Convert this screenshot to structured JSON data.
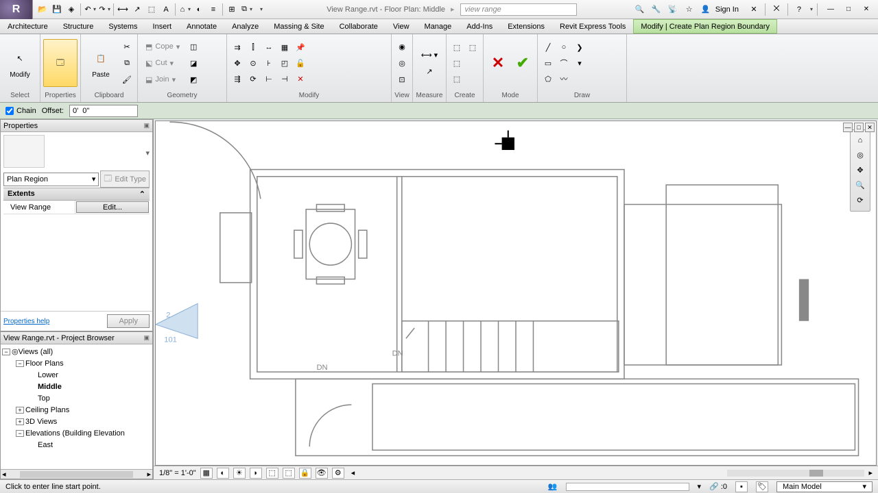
{
  "title": {
    "doc": "View Range.rvt - Floor Plan: Middle",
    "search": "view range"
  },
  "signin": "Sign In",
  "menu": [
    "Architecture",
    "Structure",
    "Systems",
    "Insert",
    "Annotate",
    "Analyze",
    "Massing & Site",
    "Collaborate",
    "View",
    "Manage",
    "Add-Ins",
    "Extensions",
    "Revit Express Tools",
    "Modify | Create Plan Region Boundary"
  ],
  "ribbon": {
    "select": {
      "title": "Select",
      "modify": "Modify"
    },
    "properties": {
      "title": "Properties"
    },
    "clipboard": {
      "title": "Clipboard",
      "paste": "Paste",
      "cope": "Cope",
      "cut": "Cut",
      "join": "Join"
    },
    "geometry": {
      "title": "Geometry"
    },
    "modify": {
      "title": "Modify"
    },
    "view": {
      "title": "View"
    },
    "measure": {
      "title": "Measure"
    },
    "create": {
      "title": "Create"
    },
    "mode": {
      "title": "Mode"
    },
    "draw": {
      "title": "Draw"
    }
  },
  "options": {
    "chain": "Chain",
    "offset_lbl": "Offset:",
    "offset_val": "0'  0\""
  },
  "props": {
    "title": "Properties",
    "type": "Plan Region",
    "edit_type": "Edit Type",
    "cat": "Extents",
    "row_lbl": "View Range",
    "row_val": "Edit...",
    "help": "Properties help",
    "apply": "Apply"
  },
  "browser": {
    "title": "View Range.rvt - Project Browser",
    "views": "Views (all)",
    "floor_plans": "Floor Plans",
    "lower": "Lower",
    "middle": "Middle",
    "top": "Top",
    "ceiling": "Ceiling Plans",
    "threeD": "3D Views",
    "elev": "Elevations (Building Elevation",
    "east": "East"
  },
  "canvas": {
    "scale": "1/8\" = 1'-0\"",
    "dn1": "DN",
    "dn2": "DN",
    "grid_num": "2",
    "grid_room": "101"
  },
  "status": {
    "msg": "Click to enter line start point.",
    "val": ":0",
    "workset": "Main Model"
  }
}
